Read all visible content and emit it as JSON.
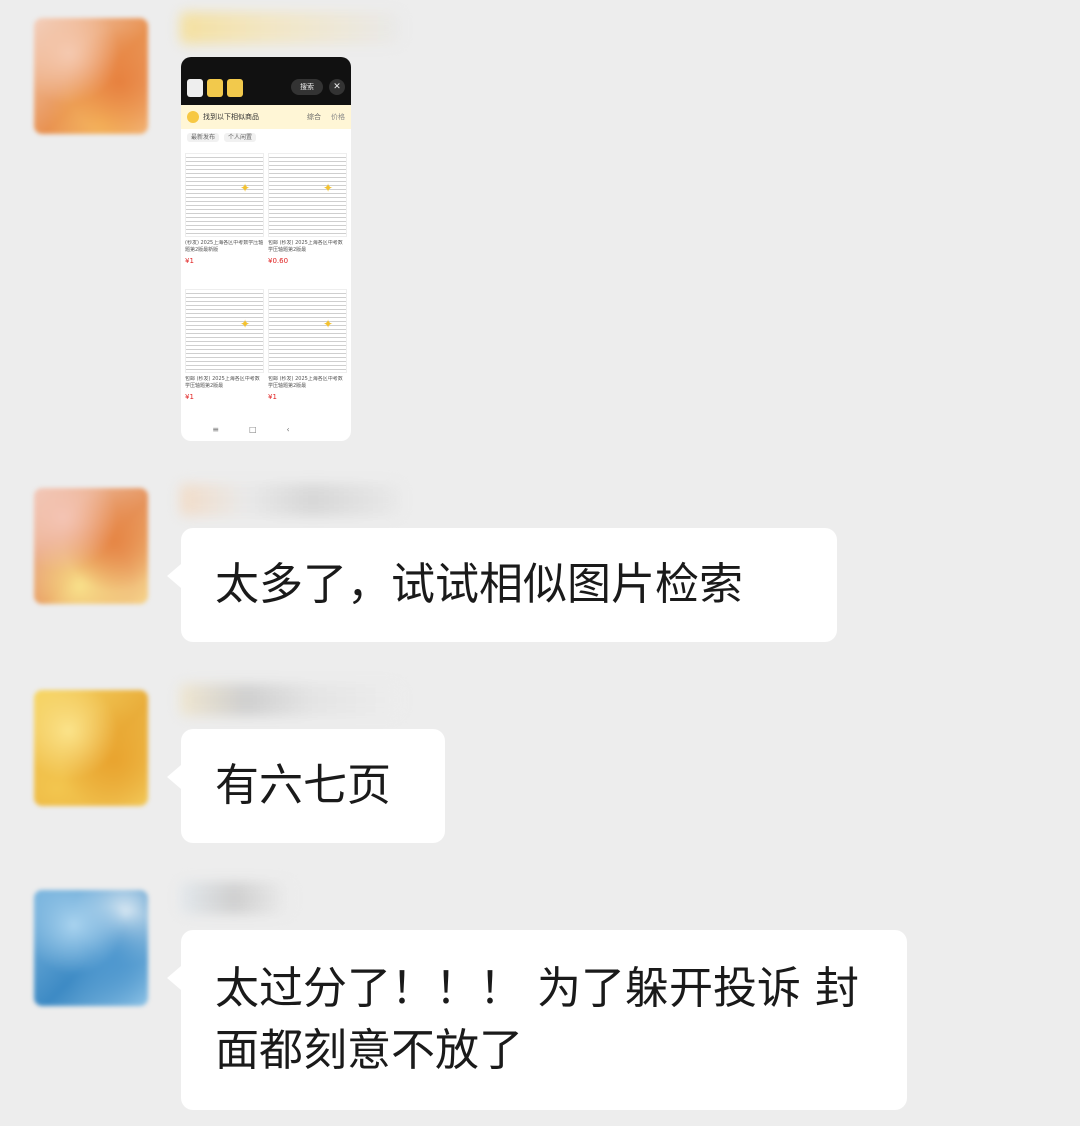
{
  "chat": {
    "messages": [
      {
        "type": "image",
        "thumbnail": {
          "search_label": "搜索",
          "close_glyph": "✕",
          "header_title": "找到以下相似商品",
          "sort_label": "综合",
          "filter_label": "价格",
          "chips": [
            "最新发布",
            "个人闲置"
          ],
          "cards": [
            {
              "title": "(秒发) 2025上海各区中考数学压轴题第2版最新版",
              "price": "¥1",
              "seller": ""
            },
            {
              "title": "包邮 (秒发) 2025上海各区中考数学压轴题第2版最",
              "price": "¥0.60",
              "seller": ""
            },
            {
              "title": "包邮 (秒发) 2025上海各区中考数学压轴题第2版最",
              "price": "¥1",
              "seller": ""
            },
            {
              "title": "包邮 (秒发) 2025上海各区中考数学压轴题第2版最",
              "price": "¥1",
              "seller": ""
            }
          ],
          "nav_icons": [
            "≡",
            "□",
            "‹"
          ]
        }
      },
      {
        "type": "text",
        "text": "太多了，试试相似图片检索"
      },
      {
        "type": "text",
        "text": "有六七页"
      },
      {
        "type": "text",
        "text": "太过分了！！！ 为了躲开投诉 封面都刻意不放了"
      }
    ]
  },
  "colors": {
    "background": "#ededed",
    "bubble": "#ffffff",
    "text": "#1a1a1a",
    "price": "#e02020"
  }
}
